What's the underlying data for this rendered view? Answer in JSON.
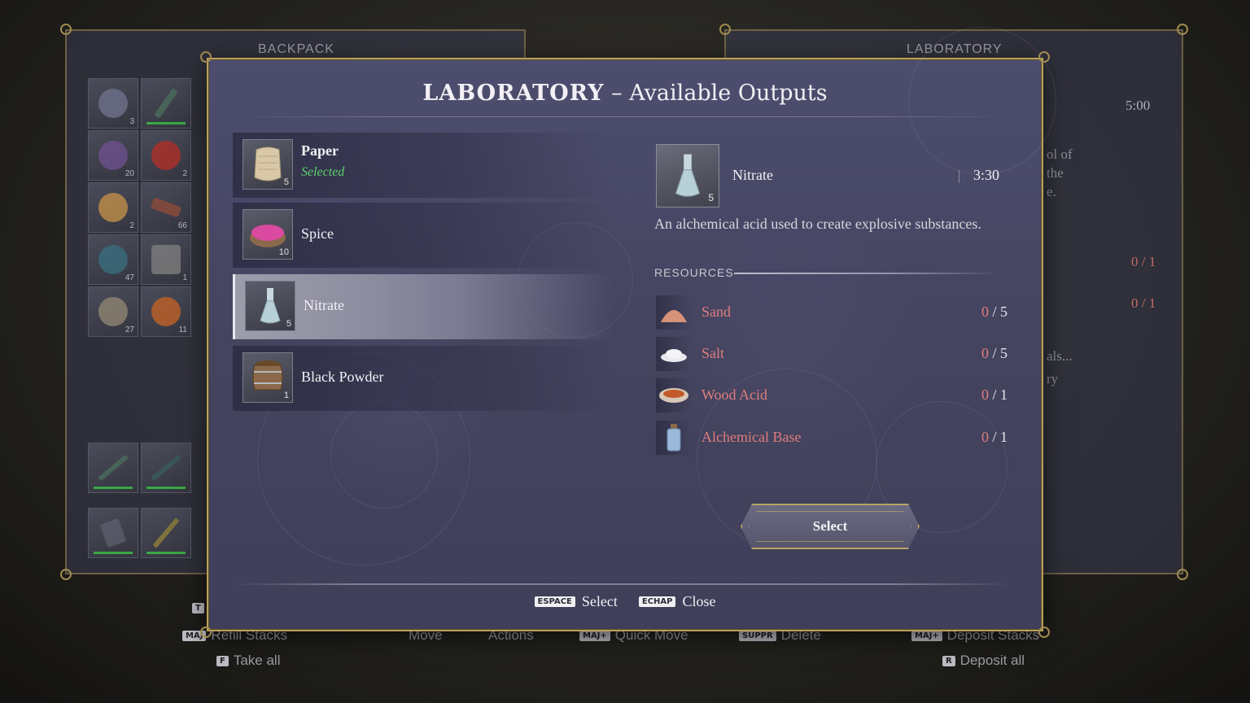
{
  "background": {
    "left_panel_title": "BACKPACK",
    "right_panel_title": "LABORATORY",
    "right_time": "5:00",
    "right_desc_lines": [
      "ol of",
      "the",
      "e."
    ],
    "right_counts": [
      "0 / 1",
      "0 / 1"
    ],
    "right_desc2_lines": [
      "als...",
      "ry"
    ],
    "backpack_counts": [
      "3",
      "",
      "20",
      "2",
      "2",
      "66",
      "47",
      "1",
      "27",
      "11"
    ],
    "hints": {
      "refill_stacks": "Refill Stacks",
      "move": "Move",
      "actions": "Actions",
      "quick_move": "Quick Move",
      "delete": "Delete",
      "deposit_stacks": "Deposit Stacks",
      "take_all": "Take all",
      "deposit_all": "Deposit all",
      "key_t": "T",
      "key_maj": "MAJ",
      "key_maj_plus": "MAJ+",
      "key_suppr": "SUPPR",
      "key_f": "F",
      "key_r": "R"
    }
  },
  "modal": {
    "title_bold": "LABORATORY",
    "title_rest": " – Available Outputs",
    "recipes": [
      {
        "name": "Paper",
        "sub": "Selected",
        "count": "5",
        "icon": "paper-icon",
        "color": "#d8c8a8"
      },
      {
        "name": "Spice",
        "sub": "",
        "count": "10",
        "icon": "spice-icon",
        "color": "#d94aa0"
      },
      {
        "name": "Nitrate",
        "sub": "",
        "count": "5",
        "icon": "nitrate-flask-icon",
        "color": "#b8d0d8"
      },
      {
        "name": "Black Powder",
        "sub": "",
        "count": "1",
        "icon": "black-powder-barrel-icon",
        "color": "#8a6a4a"
      }
    ],
    "detail": {
      "name": "Nitrate",
      "count": "5",
      "time": "3:30",
      "description": "An alchemical acid used to create explosive substances.",
      "resources_label": "RESOURCES",
      "resources": [
        {
          "name": "Sand",
          "have": "0",
          "need": "5",
          "icon": "sand-icon",
          "color": "#d8927a"
        },
        {
          "name": "Salt",
          "have": "0",
          "need": "5",
          "icon": "salt-icon",
          "color": "#e8e8ee"
        },
        {
          "name": "Wood Acid",
          "have": "0",
          "need": "1",
          "icon": "wood-acid-bowl-icon",
          "color": "#c25a2a"
        },
        {
          "name": "Alchemical Base",
          "have": "0",
          "need": "1",
          "icon": "alchemical-base-bottle-icon",
          "color": "#9ab8d8"
        }
      ]
    },
    "select_button": "Select",
    "footer": {
      "select_key": "ESPACE",
      "select_label": "Select",
      "close_key": "ECHAP",
      "close_label": "Close"
    }
  },
  "colors": {
    "frame_gold": "#b9a15a",
    "modal_bg": "#48486a",
    "selected_green": "#5fd36a",
    "missing_red": "#e07c7c"
  }
}
